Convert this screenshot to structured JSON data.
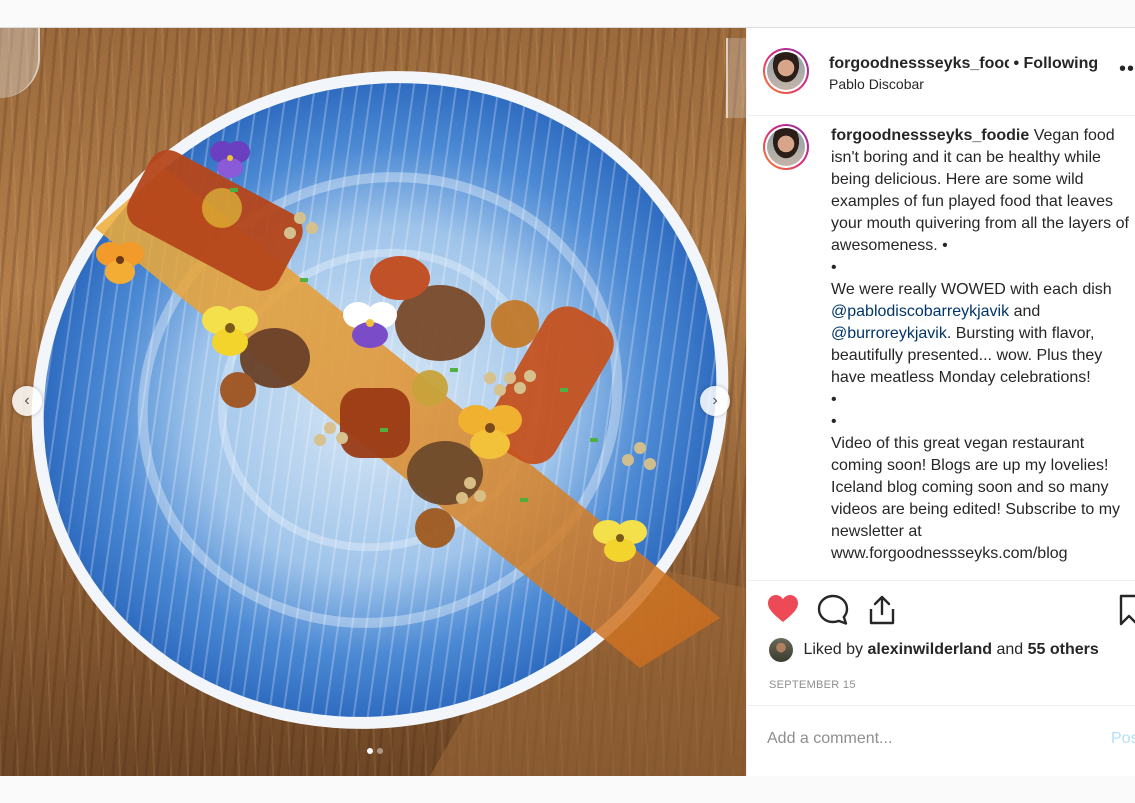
{
  "post": {
    "username": "forgoodnessseyks_foodie",
    "username_truncated": "forgoodnessseyks_food",
    "separator": "•",
    "follow_status": "Following",
    "location": "Pablo Discobar",
    "more_label": "•••",
    "caption": {
      "username": "forgoodnessseyks_foodie",
      "text1": "Vegan food isn't boring and it can be healthy while being delicious. Here are some wild examples of fun played food that leaves your mouth quivering from all the layers of awesomeness. •",
      "bullet": "•",
      "text2_before": "We were really WOWED with each dish",
      "mention1": "@pablodiscobarreykjavik",
      "text2_and": "and",
      "mention2": "@burroreykjavik",
      "text2_after": ". Bursting with flavor, beautifully presented... wow. Plus they have meatless Monday celebrations!",
      "text3": "Video of this great vegan restaurant coming soon! Blogs are up my lovelies! Iceland blog coming soon and so many videos are being edited! Subscribe to my newsletter at www.forgoodnessseyks.com/blog"
    },
    "likes": {
      "prefix": "Liked by",
      "user": "alexinwilderland",
      "and": "and",
      "others": "55 others"
    },
    "date": "SEPTEMBER 15",
    "comment": {
      "placeholder": "Add a comment...",
      "post_label": "Post"
    },
    "carousel": {
      "prev_label": "‹",
      "next_label": "›",
      "count": 2,
      "active_index": 0
    },
    "icons": {
      "like": "heart-icon",
      "comment": "comment-icon",
      "share": "share-icon",
      "save": "bookmark-icon"
    },
    "colors": {
      "heart": "#ed4956",
      "mention": "#003569",
      "post_button": "#b2dffc"
    }
  }
}
